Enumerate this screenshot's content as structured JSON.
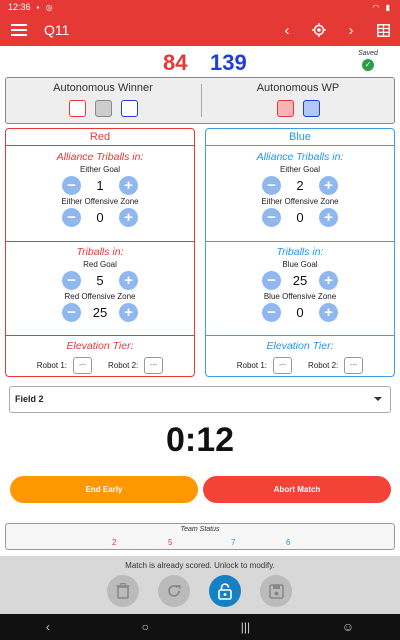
{
  "status_bar": {
    "time": "12:36"
  },
  "app_bar": {
    "title": "Q11",
    "icons": [
      "menu-icon",
      "chevron-left-icon",
      "target-icon",
      "chevron-right-icon",
      "grid-icon"
    ]
  },
  "scores": {
    "red": "84",
    "blue": "139"
  },
  "saved": {
    "label": "Saved"
  },
  "autonomous": {
    "winner_title": "Autonomous Winner",
    "wp_title": "Autonomous WP"
  },
  "red_panel": {
    "title": "Red",
    "alliance_title": "Alliance Triballs in:",
    "either_goal_label": "Either Goal",
    "either_goal_value": "1",
    "either_zone_label": "Either Offensive Zone",
    "either_zone_value": "0",
    "triballs_title": "Triballs in:",
    "goal_label": "Red Goal",
    "goal_value": "5",
    "zone_label": "Red Offensive Zone",
    "zone_value": "25",
    "elevation_title": "Elevation Tier:",
    "robot1_label": "Robot 1:",
    "robot1_value": "---",
    "robot2_label": "Robot 2:",
    "robot2_value": "---"
  },
  "blue_panel": {
    "title": "Blue",
    "alliance_title": "Alliance Triballs in:",
    "either_goal_label": "Either Goal",
    "either_goal_value": "2",
    "either_zone_label": "Either Offensive Zone",
    "either_zone_value": "0",
    "triballs_title": "Triballs in:",
    "goal_label": "Blue Goal",
    "goal_value": "25",
    "zone_label": "Blue Offensive Zone",
    "zone_value": "0",
    "elevation_title": "Elevation Tier:",
    "robot1_label": "Robot 1:",
    "robot1_value": "---",
    "robot2_label": "Robot 2:",
    "robot2_value": "---"
  },
  "stepper": {
    "minus": "−",
    "plus": "+"
  },
  "field": {
    "selected": "Field 2"
  },
  "timer": "0:12",
  "buttons": {
    "end_early": "End Early",
    "abort": "Abort Match"
  },
  "team_status": {
    "title": "Team Status",
    "values": [
      "2",
      "5",
      "7",
      "6"
    ]
  },
  "lock": {
    "message": "Match is already scored. Unlock to modify."
  },
  "colors": {
    "red": "#e53935",
    "blue": "#1e3fd8",
    "orange": "#ff9800",
    "accent": "#1680c4"
  }
}
